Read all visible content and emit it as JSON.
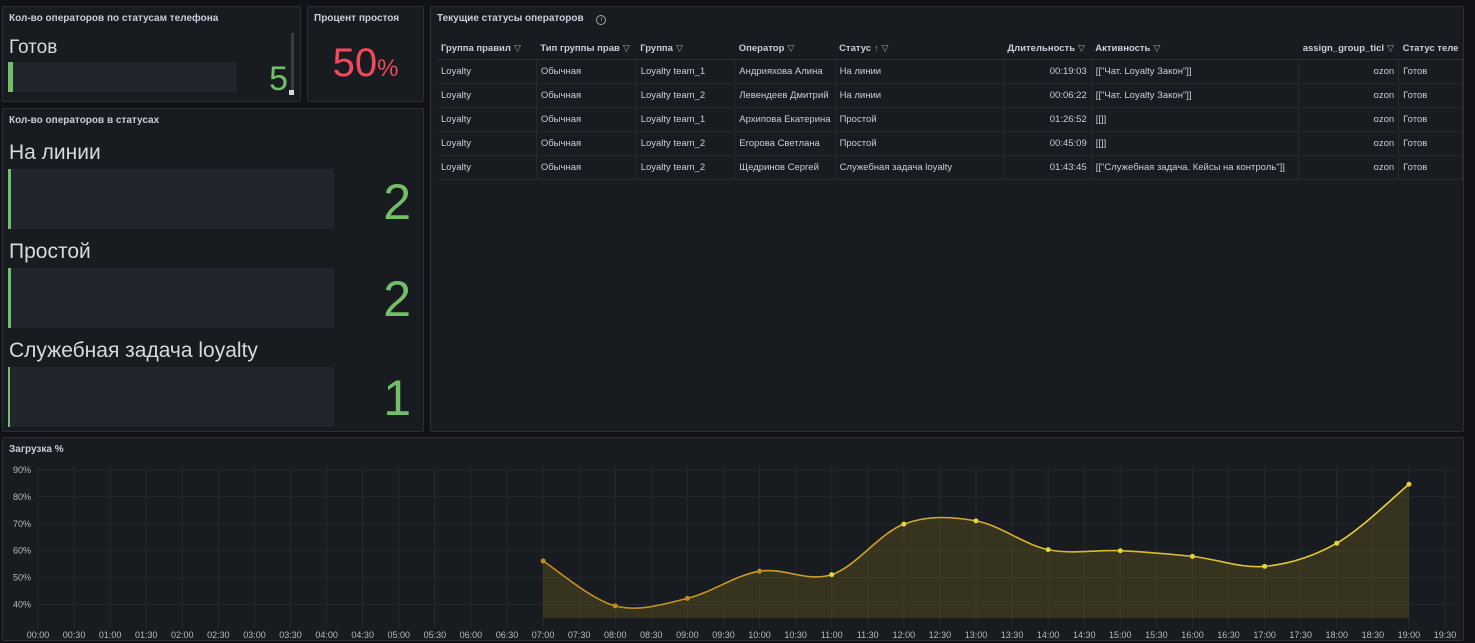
{
  "colors": {
    "green": "#73bf69",
    "red": "#f2495c",
    "yellow": "#e0c62c"
  },
  "phone_status_panel": {
    "title": "Кол-во операторов по статусам телефона",
    "items": [
      {
        "label": "Готов",
        "value": "5",
        "fill": 0.83
      }
    ]
  },
  "idle_panel": {
    "title": "Процент простоя",
    "value": "50",
    "unit": "%"
  },
  "status_counts_panel": {
    "title": "Кол-во операторов в статусах",
    "items": [
      {
        "label": "На линии",
        "value": "2",
        "fill": 0.0
      },
      {
        "label": "Простой",
        "value": "2",
        "fill": 0.0
      },
      {
        "label": "Служебная задача loyalty",
        "value": "1",
        "fill": 0.0
      }
    ]
  },
  "operators_table": {
    "title": "Текущие статусы операторов",
    "columns": [
      "Группа правил",
      "Тип группы прав",
      "Группа",
      "Оператор",
      "Статус",
      "Длительность",
      "Активность",
      "assign_group_ticl",
      "Статус теле"
    ],
    "rows": [
      [
        "Loyalty",
        "Обычная",
        "Loyalty team_1",
        "Андрияхова Алина",
        "На линии",
        "00:19:03",
        "[[\"Чат. Loyalty Закон\"]]",
        "ozon",
        "Готов"
      ],
      [
        "Loyalty",
        "Обычная",
        "Loyalty team_2",
        "Левендеев Дмитрий",
        "На линии",
        "00:06:22",
        "[[\"Чат. Loyalty Закон\"]]",
        "ozon",
        "Готов"
      ],
      [
        "Loyalty",
        "Обычная",
        "Loyalty team_1",
        "Архипова Екатерина",
        "Простой",
        "01:26:52",
        "[[]]",
        "ozon",
        "Готов"
      ],
      [
        "Loyalty",
        "Обычная",
        "Loyalty team_2",
        "Егорова Светлана",
        "Простой",
        "00:45:09",
        "[[]]",
        "ozon",
        "Готов"
      ],
      [
        "Loyalty",
        "Обычная",
        "Loyalty team_2",
        "Щедринов Сергей",
        "Служебная задача loyalty",
        "01:43:45",
        "[[\"Служебная задача. Кейсы на контроль\"]]",
        "ozon",
        "Готов"
      ]
    ]
  },
  "load_panel": {
    "title": "Загрузка %"
  },
  "chart_data": {
    "type": "area",
    "title": "Загрузка %",
    "ylim": [
      35,
      90
    ],
    "y_ticks": [
      "40%",
      "50%",
      "60%",
      "70%",
      "80%",
      "90%"
    ],
    "x_ticks": [
      "00:00",
      "00:30",
      "01:00",
      "01:30",
      "02:00",
      "02:30",
      "03:00",
      "03:30",
      "04:00",
      "04:30",
      "05:00",
      "05:30",
      "06:00",
      "06:30",
      "07:00",
      "07:30",
      "08:00",
      "08:30",
      "09:00",
      "09:30",
      "10:00",
      "10:30",
      "11:00",
      "11:30",
      "12:00",
      "12:30",
      "13:00",
      "13:30",
      "14:00",
      "14:30",
      "15:00",
      "15:30",
      "16:00",
      "16:30",
      "17:00",
      "17:30",
      "18:00",
      "18:30",
      "19:00",
      "19:30"
    ],
    "x": [
      "07:00",
      "08:00",
      "09:00",
      "10:00",
      "11:00",
      "12:00",
      "13:00",
      "14:00",
      "15:00",
      "16:00",
      "17:00",
      "18:00",
      "19:00"
    ],
    "values": [
      56.2,
      39.5,
      42.3,
      52.4,
      51.1,
      69.9,
      71.1,
      60.4,
      60.0,
      57.9,
      54.2,
      62.8,
      84.7
    ],
    "grid": true
  }
}
